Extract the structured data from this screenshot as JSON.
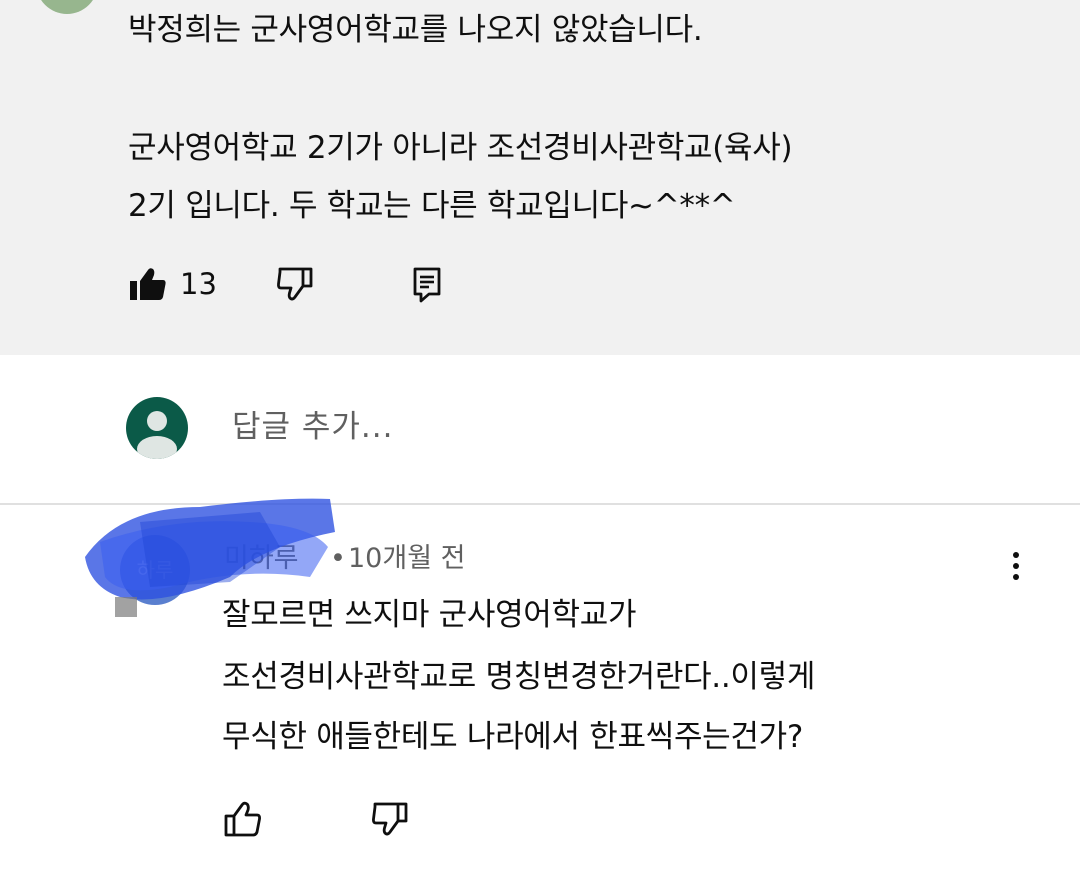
{
  "first_comment": {
    "lines": [
      "박정희는 군사영어학교를 나오지 않았습니다.",
      "군사영어학교 2기가 아니라 조선경비사관학교(육사)",
      "2기 입니다. 두 학교는 다른 학교입니다~^**^"
    ],
    "like_count": "13",
    "liked": true,
    "icons": [
      "thumbs-up-filled-icon",
      "thumbs-down-icon",
      "reply-comment-icon"
    ]
  },
  "reply_box": {
    "placeholder": "답글 추가..."
  },
  "second_comment": {
    "author": "미하루",
    "avatar_text": "하루",
    "separator": "•",
    "timestamp": "10개월 전",
    "lines": [
      "잘모르면 쓰지마 군사영어학교가",
      "조선경비사관학교로 명칭변경한거란다..이렇게",
      "무식한 애들한테도 나라에서 한표씩주는건가?"
    ],
    "icons": [
      "thumbs-up-icon",
      "thumbs-down-icon",
      "more-vert-icon"
    ]
  },
  "colors": {
    "comment_bg": "#f1f1f1",
    "text": "#0f0f0f",
    "meta_text": "#606060",
    "reply_avatar": "#0b5a48",
    "redaction": "#2b4fe0"
  }
}
